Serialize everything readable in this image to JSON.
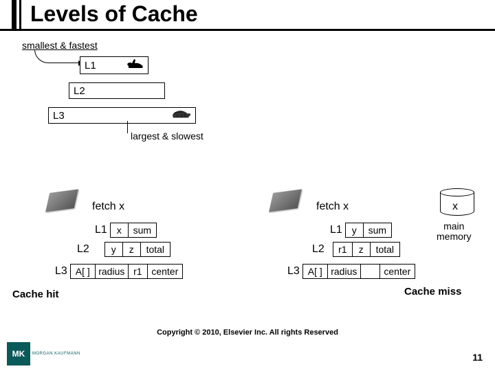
{
  "title": "Levels of Cache",
  "labels": {
    "smallest": "smallest & fastest",
    "largest": "largest & slowest",
    "fetch": "fetch x",
    "main_memory_l1": "main",
    "main_memory_l2": "memory",
    "cache_hit": "Cache hit",
    "cache_miss": "Cache miss",
    "mem_var": "x"
  },
  "levels": {
    "l1": "L1",
    "l2": "L2",
    "l3": "L3"
  },
  "left": {
    "l1": [
      "x",
      "sum"
    ],
    "l2": [
      "y",
      "z",
      "total"
    ],
    "l3": [
      "A[ ]",
      "radius",
      "r1",
      "center"
    ]
  },
  "right": {
    "l1": [
      "y",
      "sum"
    ],
    "l2": [
      "r1",
      "z",
      "total"
    ],
    "l3": [
      "A[ ]",
      "radius",
      "",
      "center"
    ]
  },
  "footer": {
    "copyright": "Copyright © 2010, Elsevier Inc. All rights Reserved",
    "page": "11",
    "logo_mark": "MK",
    "logo_text": "MORGAN KAUFMANN"
  }
}
